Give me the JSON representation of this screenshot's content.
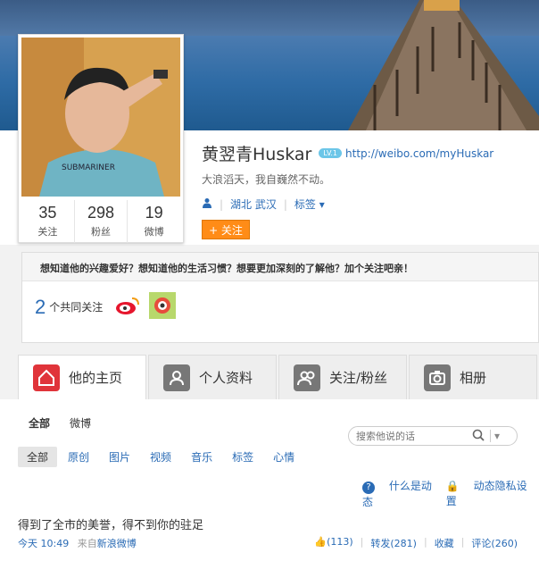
{
  "profile": {
    "name": "黄翌青Huskar",
    "level": "LV.1",
    "url": "http://weibo.com/myHuskar",
    "bio": "大浪滔天，我自巍然不动。",
    "location": "湖北 武汉",
    "tags_label": "标签",
    "follow_button": "+ 关注",
    "stats": [
      {
        "num": "35",
        "label": "关注"
      },
      {
        "num": "298",
        "label": "粉丝"
      },
      {
        "num": "19",
        "label": "微博"
      }
    ]
  },
  "promo": {
    "headline": "想知道他的兴趣爱好？想知道他的生活习惯？想要更加深刻的了解他？加个关注吧亲！",
    "mutual_count": "2",
    "mutual_label": "个共同关注"
  },
  "tabs": [
    {
      "label": "他的主页"
    },
    {
      "label": "个人资料"
    },
    {
      "label": "关注/粉丝"
    },
    {
      "label": "相册"
    }
  ],
  "feed": {
    "sub_tabs": [
      "全部",
      "微博"
    ],
    "search_placeholder": "搜索他说的话",
    "filters": [
      "全部",
      "原创",
      "图片",
      "视频",
      "音乐",
      "标签",
      "心情"
    ],
    "help_link": "什么是动态",
    "privacy_link": "动态隐私设置",
    "post": {
      "text": "得到了全市的美誉，得不到你的驻足",
      "time": "今天 10:49",
      "source_prefix": "来自",
      "source": "新浪微博",
      "like": "(113)",
      "repost": "转发(281)",
      "favorite": "收藏",
      "comment": "评论(260)"
    }
  },
  "colors": {
    "link": "#2a6bb5",
    "follow": "#ff8c17",
    "active_tab_icon": "#e0343a",
    "tab_icon": "#777777"
  }
}
